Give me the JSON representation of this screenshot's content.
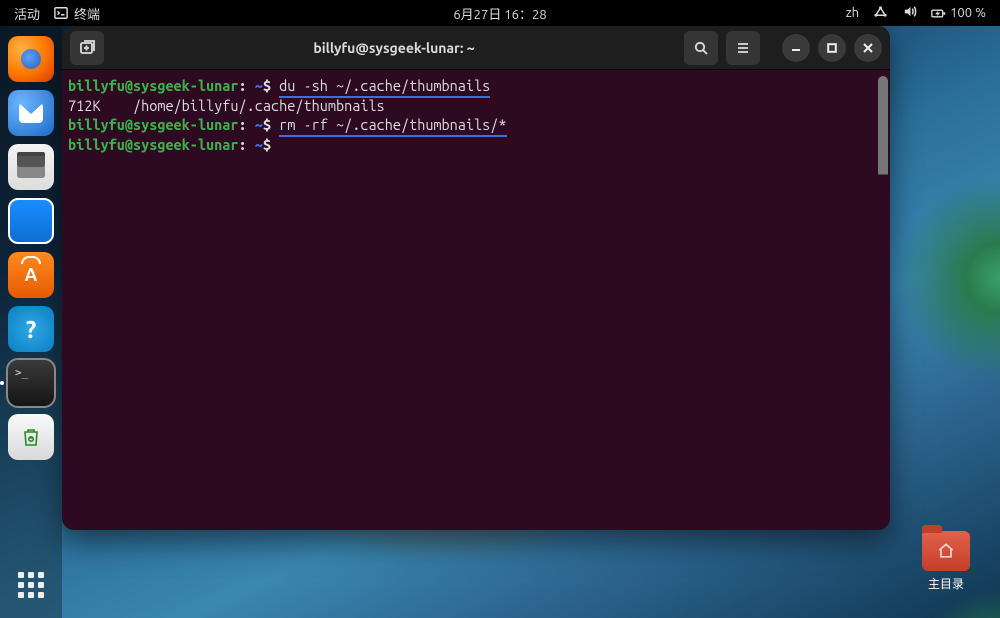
{
  "topbar": {
    "activities": "活动",
    "app_name": "终端",
    "datetime": "6月27日  16：28",
    "input_method": "zh",
    "battery": "100 %"
  },
  "dock": {
    "items": [
      {
        "name": "firefox"
      },
      {
        "name": "thunderbird"
      },
      {
        "name": "files"
      },
      {
        "name": "writer"
      },
      {
        "name": "software"
      },
      {
        "name": "help"
      },
      {
        "name": "terminal",
        "active": true
      },
      {
        "name": "trash"
      }
    ]
  },
  "desktop": {
    "home_label": "主目录"
  },
  "terminal_window": {
    "title": "billyfu@sysgeek-lunar: ~"
  },
  "terminal": {
    "prompt_user": "billyfu@sysgeek-lunar",
    "prompt_path": "~",
    "line1_cmd": "du -sh ~/.cache/thumbnails",
    "line2": "712K    /home/billyfu/.cache/thumbnails",
    "line3_cmd": "rm -rf ~/.cache/thumbnails/*"
  }
}
